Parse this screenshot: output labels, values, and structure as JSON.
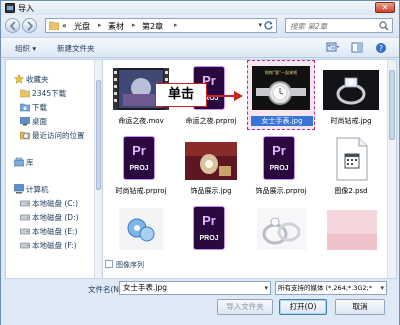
{
  "window": {
    "title": "导入",
    "close": "✕"
  },
  "address": {
    "prefix": "«",
    "crumbs": [
      "光盘",
      "素材",
      "第2章"
    ],
    "search_placeholder": "搜索 第2章"
  },
  "toolbar": {
    "organize": "组织 ▾",
    "new_folder": "新建文件夹"
  },
  "sidebar": {
    "favorites": "收藏夹",
    "fav_items": [
      "2345下载",
      "下载",
      "桌面",
      "最近访问的位置"
    ],
    "library": "库",
    "computer": "计算机",
    "drives": [
      "本地磁盘 (C:)",
      "本地磁盘 (D:)",
      "本地磁盘 (E:)",
      "本地磁盘 (F:)"
    ]
  },
  "files": [
    {
      "name": "命运之夜.mov",
      "kind": "video"
    },
    {
      "name": "命运之夜.prproj",
      "kind": "proj"
    },
    {
      "name": "女士手表.jpg",
      "kind": "watch",
      "selected": true
    },
    {
      "name": "时尚钻戒.jpg",
      "kind": "ring"
    },
    {
      "name": "时尚钻戒.prproj",
      "kind": "proj"
    },
    {
      "name": "饰品展示.jpg",
      "kind": "jewel"
    },
    {
      "name": "饰品展示.prproj",
      "kind": "proj"
    },
    {
      "name": "图像2.psd",
      "kind": "psd"
    },
    {
      "name": "",
      "kind": "earring"
    },
    {
      "name": "",
      "kind": "proj"
    },
    {
      "name": "",
      "kind": "rings2"
    },
    {
      "name": "",
      "kind": "blank"
    }
  ],
  "pr_icon": {
    "top": "Pr",
    "bottom": "PROJ"
  },
  "watch_caption": "购物“惠”一起来吧",
  "callout": "单击",
  "image_sequence": "图像序列",
  "bottom": {
    "filename_label": "文件名(N):",
    "filename_value": "女士手表.jpg",
    "filetype_value": "所有支持的媒体 (*.264;*.3G2;*",
    "import_folder": "导入文件夹",
    "open": "打开(O)",
    "cancel": "取消"
  },
  "colors": {
    "selected_border": "#b03090",
    "accent": "#3875d7",
    "pr_bg": "#2a0a3e"
  }
}
